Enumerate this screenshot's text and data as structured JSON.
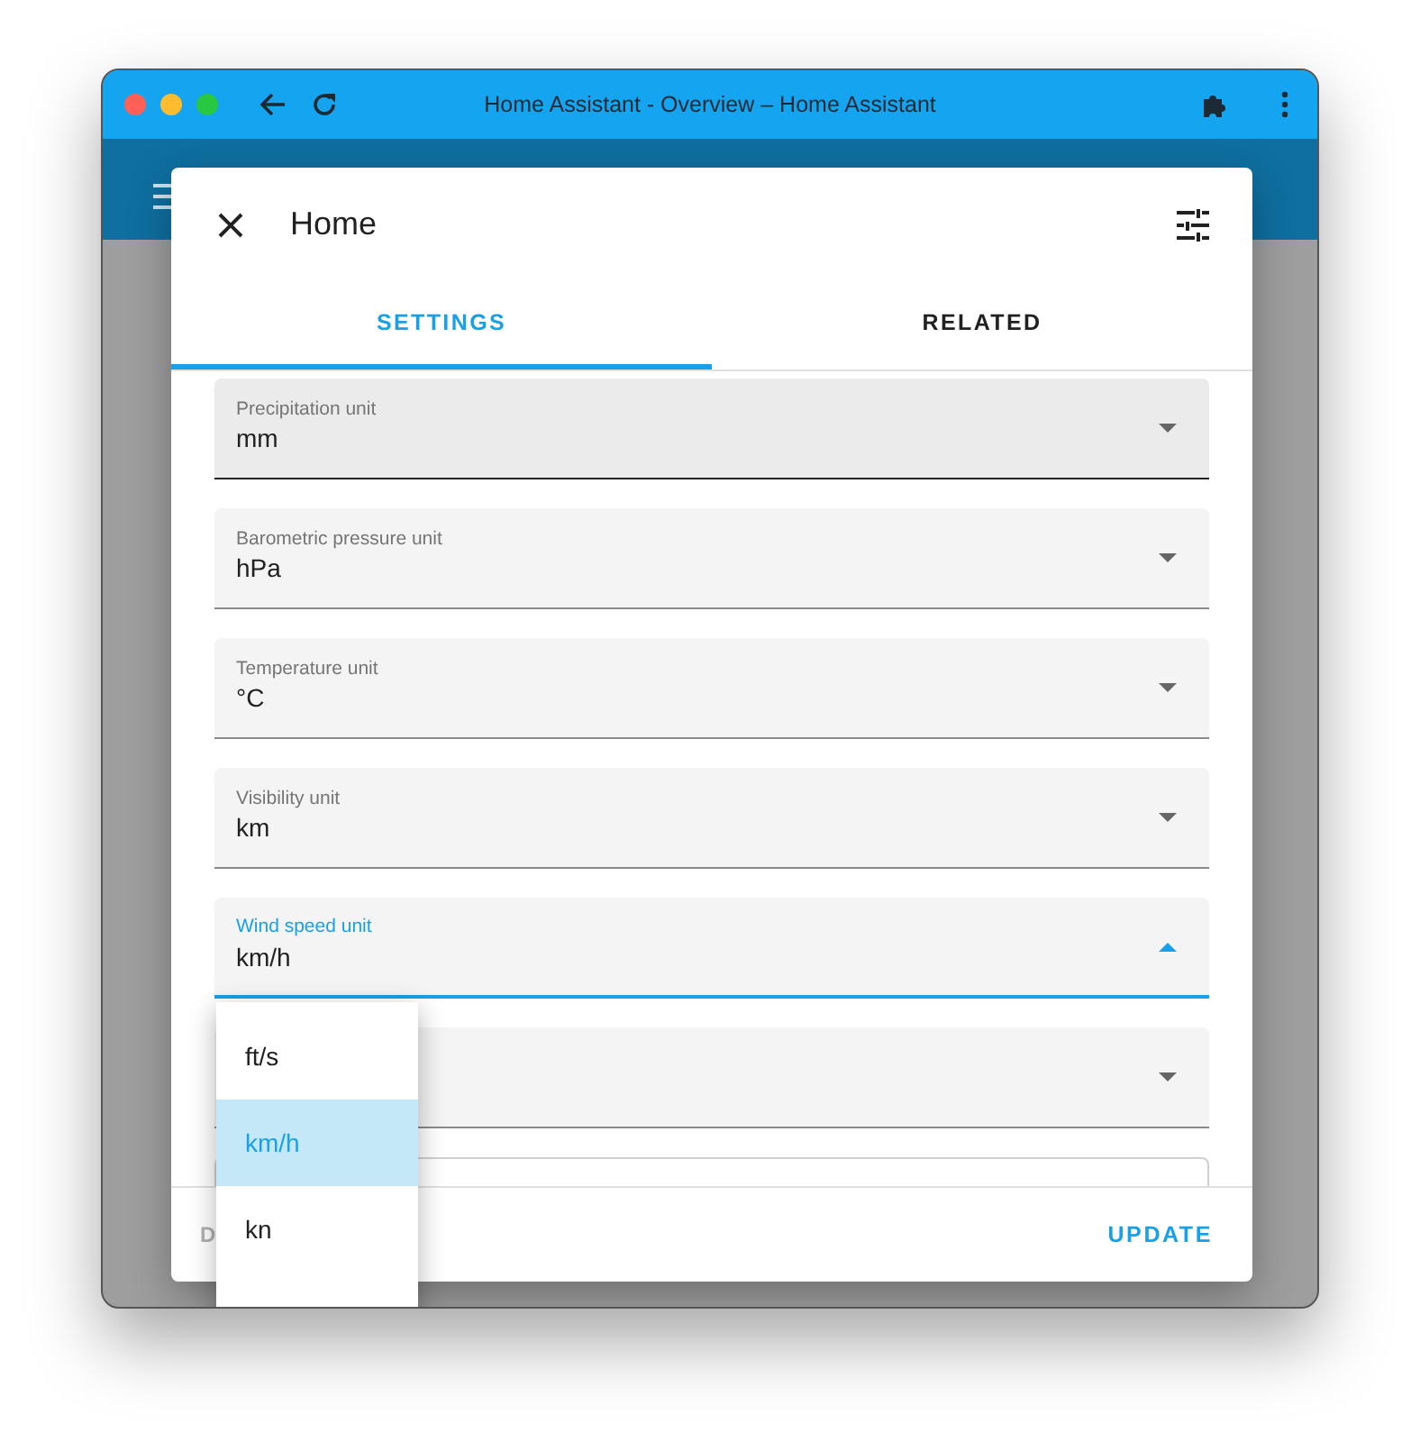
{
  "window": {
    "title": "Home Assistant - Overview – Home Assistant"
  },
  "dialog": {
    "title": "Home",
    "tabs": [
      {
        "label": "SETTINGS",
        "selected": true
      },
      {
        "label": "RELATED",
        "selected": false
      }
    ],
    "fields": [
      {
        "kind": "filled",
        "label": "Precipitation unit",
        "value": "mm",
        "hovered": true,
        "open": false
      },
      {
        "kind": "filled",
        "label": "Barometric pressure unit",
        "value": "hPa",
        "hovered": false,
        "open": false
      },
      {
        "kind": "filled",
        "label": "Temperature unit",
        "value": "°C",
        "hovered": false,
        "open": false
      },
      {
        "kind": "filled",
        "label": "Visibility unit",
        "value": "km",
        "hovered": false,
        "open": false
      },
      {
        "kind": "filled",
        "label": "Wind speed unit",
        "value": "km/h",
        "hovered": false,
        "open": true
      },
      {
        "kind": "filled",
        "hovered": false,
        "open": false
      },
      {
        "kind": "outlined"
      }
    ],
    "footer": {
      "secondary": "D",
      "primary": "UPDATE"
    }
  },
  "menu": {
    "items": [
      {
        "label": "ft/s",
        "selected": false
      },
      {
        "label": "km/h",
        "selected": true
      },
      {
        "label": "kn",
        "selected": false
      }
    ]
  }
}
